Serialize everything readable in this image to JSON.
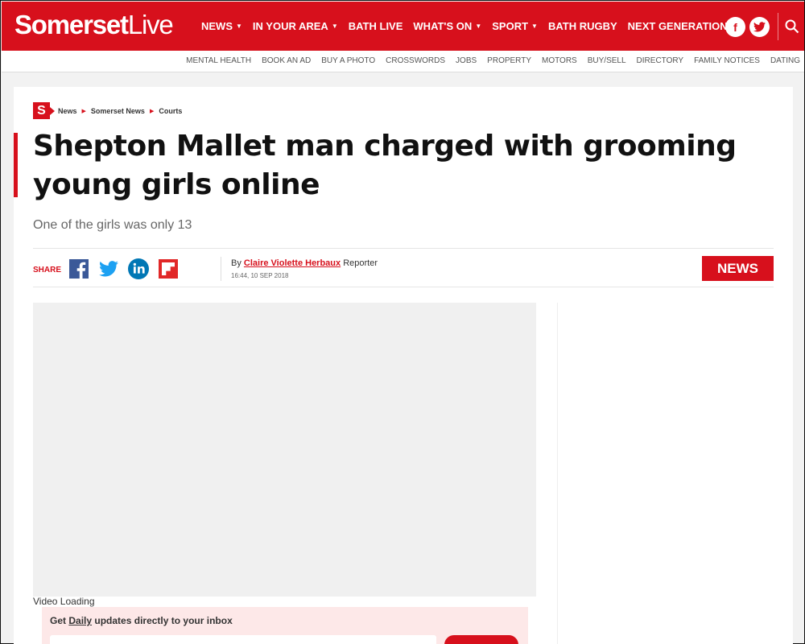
{
  "brand": {
    "name_bold": "Somerset",
    "name_light": "Live",
    "accent": "#d7101c"
  },
  "main_nav": [
    {
      "label": "NEWS",
      "dropdown": true
    },
    {
      "label": "IN YOUR AREA",
      "dropdown": true
    },
    {
      "label": "BATH LIVE",
      "dropdown": false
    },
    {
      "label": "WHAT'S ON",
      "dropdown": true
    },
    {
      "label": "SPORT",
      "dropdown": true
    },
    {
      "label": "BATH RUGBY",
      "dropdown": false
    },
    {
      "label": "NEXT GENERATION",
      "dropdown": false
    }
  ],
  "social": {
    "facebook": "f",
    "twitter_icon": "twitter-icon"
  },
  "sub_nav": [
    "MENTAL HEALTH",
    "BOOK AN AD",
    "BUY A PHOTO",
    "CROSSWORDS",
    "JOBS",
    "PROPERTY",
    "MOTORS",
    "BUY/SELL",
    "DIRECTORY",
    "FAMILY NOTICES",
    "DATING"
  ],
  "breadcrumb": {
    "badge": "S",
    "items": [
      "News",
      "Somerset News",
      "Courts"
    ]
  },
  "article": {
    "headline": "Shepton Mallet man charged with grooming young girls online",
    "standfirst": "One of the girls was only 13",
    "share_label": "SHARE",
    "byline_prefix": "By",
    "author": "Claire Violette Herbaux",
    "author_role": "Reporter",
    "dateline": "16:44, 10 SEP 2018",
    "category": "NEWS"
  },
  "video": {
    "status": "Video Loading"
  },
  "newsletter": {
    "prefix": "Get",
    "frequency": "Daily",
    "suffix": "updates directly to your inbox"
  }
}
